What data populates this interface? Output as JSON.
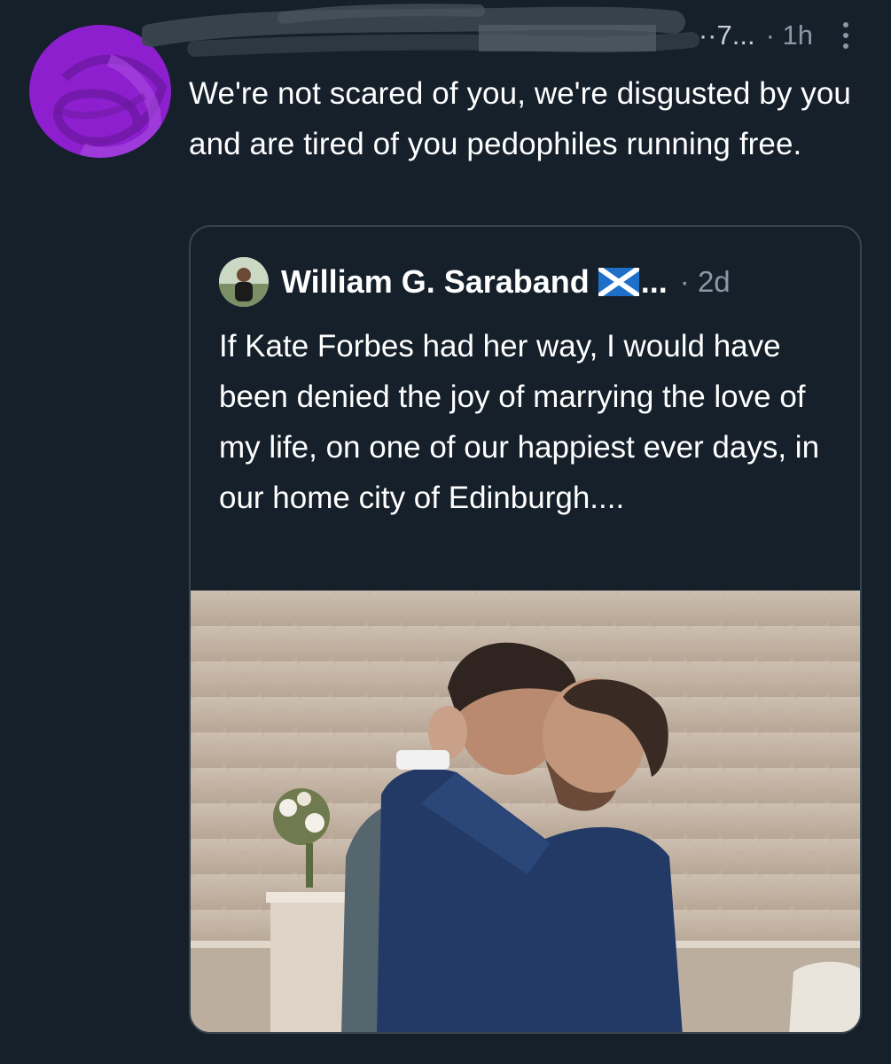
{
  "tweet": {
    "name_tail": "··7...",
    "timestamp": "· 1h",
    "text": "We're not scared of you, we're disgusted by you and are tired of you pedophiles running free."
  },
  "quoted_tweet": {
    "author_name": "William G. Saraband",
    "name_ellipsis": "...",
    "timestamp": "· 2d",
    "text": "If Kate Forbes had her way, I would have been denied the joy of marrying the love of my life, on one of our happiest ever days, in our home city of Edinburgh....",
    "flag_icon": "scotland-flag-icon"
  },
  "icons": {
    "more": "more-options-icon",
    "avatar": "avatar"
  },
  "colors": {
    "background": "#15202b",
    "secondary_text": "#8b98a5",
    "border": "#38444d",
    "avatar_purple": "#8d1fcf"
  }
}
